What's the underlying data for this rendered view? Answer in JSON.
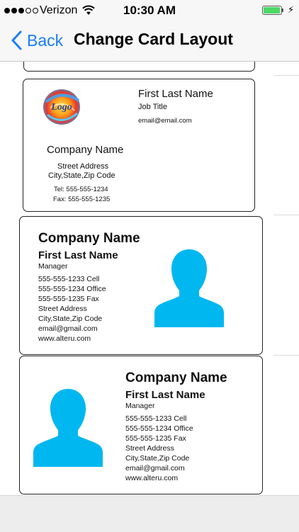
{
  "status_bar": {
    "carrier": "Verizon",
    "time": "10:30 AM",
    "signal_bars": 3,
    "signal_total": 5,
    "battery_level": 0.95,
    "wifi_icon": "wifi-icon",
    "charging_icon": "bolt-icon"
  },
  "nav": {
    "back_label": "Back",
    "title": "Change Card Layout"
  },
  "card_logo": {
    "logo_text": "Logo",
    "name": "First Last Name",
    "job_title": "Job Title",
    "email": "email@email.com",
    "company": "Company Name",
    "street": "Street Address",
    "city": "City,State,Zip Code",
    "tel": "Tel: 555-555-1234",
    "fax": "Fax: 555-555-1235"
  },
  "card_photo_right": {
    "company": "Company Name",
    "name": "First Last Name",
    "role": "Manager",
    "cell": "555-555-1233 Cell",
    "office": "555-555-1234 Office",
    "fax": "555-555-1235 Fax",
    "street": "Street Address",
    "city": "City,State,Zip Code",
    "email": "email@gmail.com",
    "website": "www.alteru.com"
  },
  "card_photo_left": {
    "company": "Company Name",
    "name": "First Last Name",
    "role": "Manager",
    "cell": "555-555-1233 Cell",
    "office": "555-555-1234 Office",
    "fax": "555-555-1235 Fax",
    "street": "Street Address",
    "city": "City,State,Zip Code",
    "email": "email@gmail.com",
    "website": "www.alteru.com"
  },
  "colors": {
    "accent": "#1a7ef5",
    "avatar": "#00b7f0",
    "battery": "#4cd964"
  }
}
